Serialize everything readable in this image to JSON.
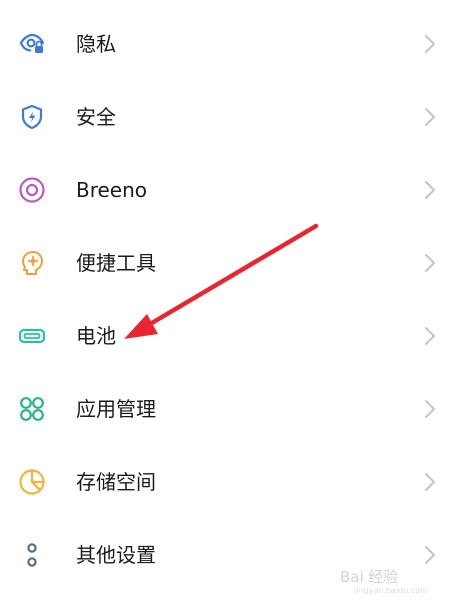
{
  "settings_list": {
    "items": [
      {
        "label": "隐私",
        "icon": "privacy-eye-icon"
      },
      {
        "label": "安全",
        "icon": "security-shield-icon"
      },
      {
        "label": "Breeno",
        "icon": "breeno-icon"
      },
      {
        "label": "便捷工具",
        "icon": "convenience-tools-icon"
      },
      {
        "label": "电池",
        "icon": "battery-icon"
      },
      {
        "label": "应用管理",
        "icon": "app-management-icon"
      },
      {
        "label": "存储空间",
        "icon": "storage-icon"
      },
      {
        "label": "其他设置",
        "icon": "other-settings-icon"
      }
    ]
  },
  "annotation": {
    "arrow_color": "#e8262f",
    "points_to": "电池"
  },
  "watermark": {
    "text": "Bai 经验",
    "subtext": "jingyan.baidu.com"
  },
  "colors": {
    "icon_blue": "#3e79d6",
    "icon_purple": "#b55cc4",
    "icon_orange": "#f0a23a",
    "icon_teal": "#2dbfa6",
    "icon_green": "#28b18c",
    "icon_yellow": "#f2b33a",
    "icon_gray_blue": "#5b6d88"
  }
}
